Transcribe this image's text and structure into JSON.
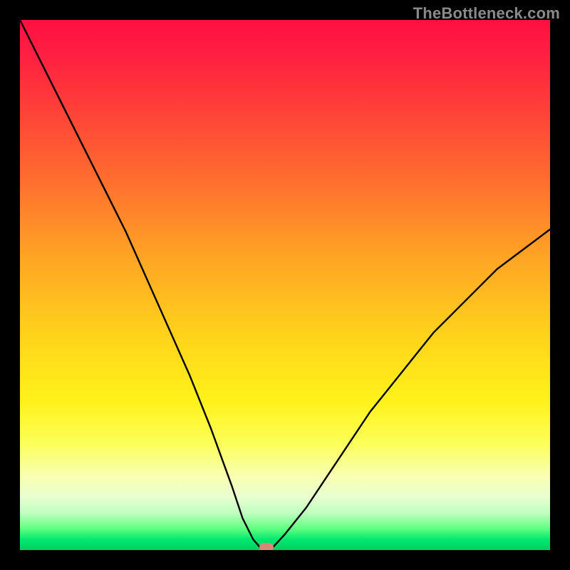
{
  "watermark": "TheBottleneck.com",
  "chart_data": {
    "type": "line",
    "title": "",
    "xlabel": "",
    "ylabel": "",
    "xlim": [
      0,
      100
    ],
    "ylim": [
      0,
      100
    ],
    "grid": false,
    "legend": false,
    "series": [
      {
        "name": "bottleneck-curve",
        "x": [
          0,
          4,
          8,
          12,
          16,
          20,
          24,
          28,
          32,
          36,
          40,
          42,
          44,
          45.3,
          47.7,
          50,
          54,
          58,
          62,
          66,
          70,
          74,
          78,
          82,
          86,
          90,
          94,
          98,
          100
        ],
        "y": [
          100,
          92,
          84,
          76,
          68,
          60,
          51,
          42,
          33,
          23,
          12,
          6,
          2,
          0.5,
          0.5,
          3,
          8,
          14,
          20,
          26,
          31,
          36,
          41,
          45,
          49,
          53,
          56,
          59,
          60.5
        ]
      }
    ],
    "optimum_point": {
      "x": 46.5,
      "y": 0.5
    },
    "colors": {
      "gradient_top": "#ff1040",
      "gradient_mid": "#ffe81a",
      "gradient_bottom": "#00d060",
      "curve": "#000000",
      "dot": "#d88878",
      "frame": "#000000",
      "watermark": "#8a8a8a"
    }
  }
}
